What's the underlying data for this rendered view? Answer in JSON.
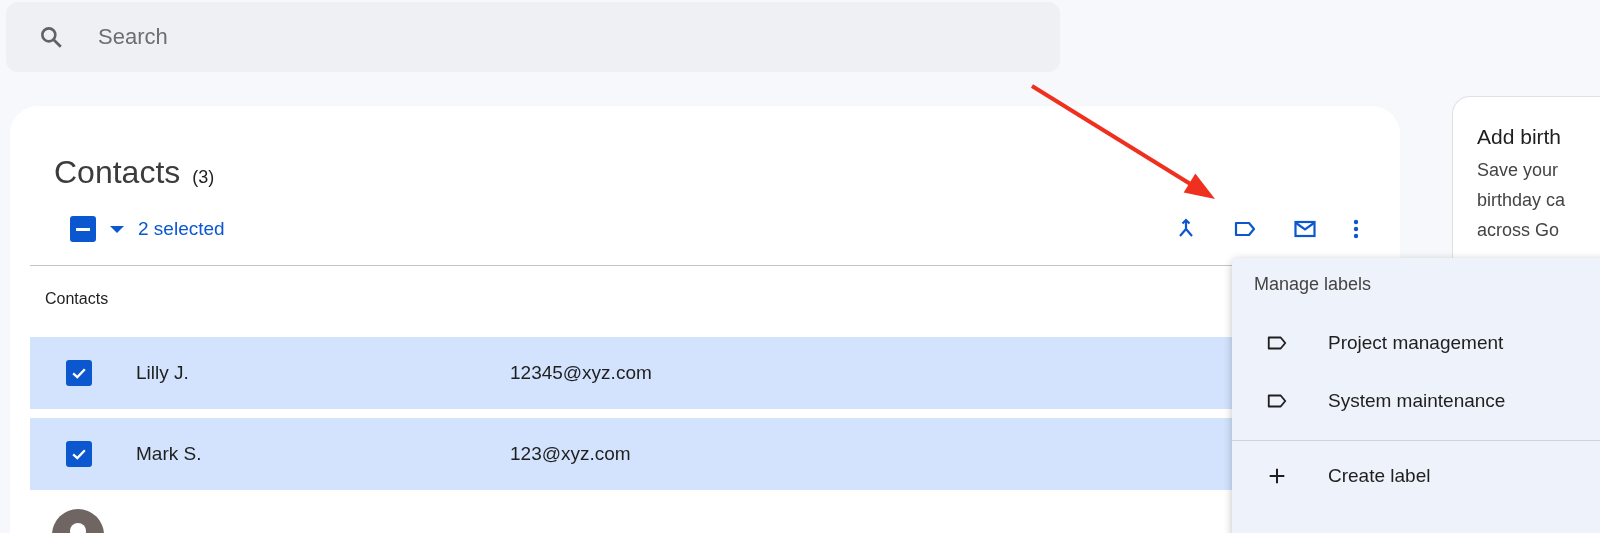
{
  "search": {
    "placeholder": "Search"
  },
  "contacts": {
    "title": "Contacts",
    "count": "(3)",
    "select_all": {
      "indeterminate": true
    },
    "selected_text": "2 selected",
    "section": "Contacts",
    "rows": [
      {
        "name": "Lilly J.",
        "email": "12345@xyz.com",
        "selected": true
      },
      {
        "name": "Mark S.",
        "email": "123@xyz.com",
        "selected": true
      },
      {
        "selected": false
      }
    ]
  },
  "label_menu": {
    "title": "Manage labels",
    "labels": [
      "Project management",
      "System maintenance"
    ],
    "create": "Create label"
  },
  "side_card": {
    "title": "Add birth",
    "lines": [
      "Save your",
      "birthday ca",
      "across Go"
    ]
  }
}
